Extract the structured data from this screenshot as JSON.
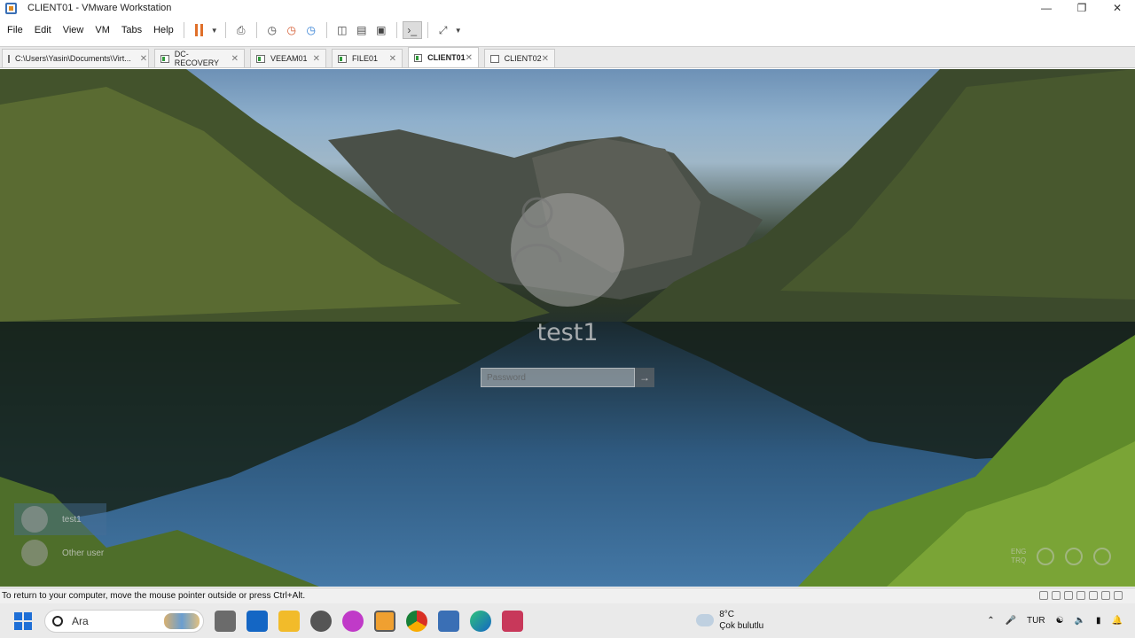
{
  "window": {
    "title": "CLIENT01 - VMware Workstation"
  },
  "menu": {
    "items": [
      "File",
      "Edit",
      "View",
      "VM",
      "Tabs",
      "Help"
    ]
  },
  "tabs": [
    {
      "label": "C:\\Users\\Yasin\\Documents\\Virt...",
      "active": false
    },
    {
      "label": "DC-RECOVERY",
      "active": false
    },
    {
      "label": "VEEAM01",
      "active": false
    },
    {
      "label": "FILE01",
      "active": false
    },
    {
      "label": "CLIENT01",
      "active": true
    },
    {
      "label": "CLIENT02",
      "active": false
    }
  ],
  "login": {
    "username": "test1",
    "password_placeholder": "Password",
    "users": [
      "test1",
      "Other user"
    ],
    "lang_top": "ENG",
    "lang_bottom": "TRQ"
  },
  "status": {
    "text": "To return to your computer, move the mouse pointer outside or press Ctrl+Alt."
  },
  "taskbar": {
    "search_placeholder": "Ara",
    "weather_temp": "8°C",
    "weather_desc": "Çok bulutlu",
    "lang": "TUR"
  },
  "colors": {
    "accent": "#1f6fd6",
    "pause": "#e0702a"
  }
}
